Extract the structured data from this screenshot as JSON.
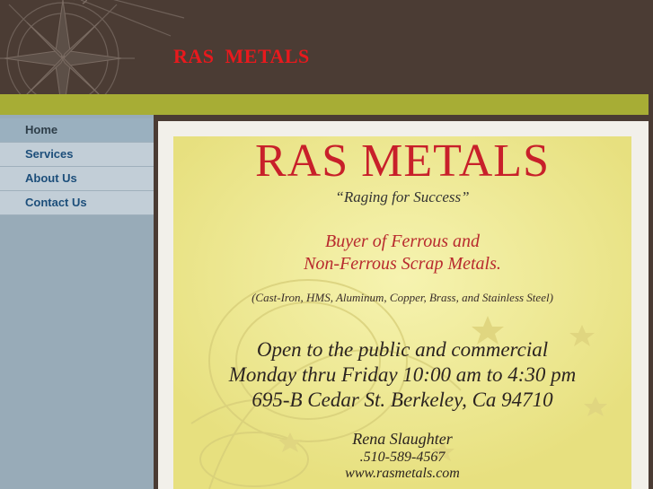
{
  "header": {
    "site_title": "RAS  METALS"
  },
  "nav": {
    "items": [
      {
        "label": "Home"
      },
      {
        "label": "Services"
      },
      {
        "label": "About Us"
      },
      {
        "label": "Contact Us"
      }
    ]
  },
  "flyer": {
    "title": "RAS METALS",
    "tagline": "“Raging for Success”",
    "buyer_line1": "Buyer of Ferrous and",
    "buyer_line2": "Non-Ferrous Scrap Metals.",
    "materials": "(Cast-Iron, HMS, Aluminum, Copper, Brass, and Stainless Steel)",
    "open_line1": "Open to the public and commercial",
    "open_line2": "Monday thru Friday 10:00 am to 4:30 pm",
    "address": "695-B Cedar St. Berkeley, Ca 94710",
    "contact_name": "Rena Slaughter",
    "phone": ".510-589-4567",
    "website": "www.rasmetals.com"
  },
  "colors": {
    "header_bg": "#4b3c34",
    "accent_band": "#a7ad35",
    "title_red": "#e8191d",
    "nav_link": "#1c4e7a",
    "flyer_bg": "#f2ee9a"
  },
  "icons": {
    "header_decoration": "compass-rose-icon"
  }
}
